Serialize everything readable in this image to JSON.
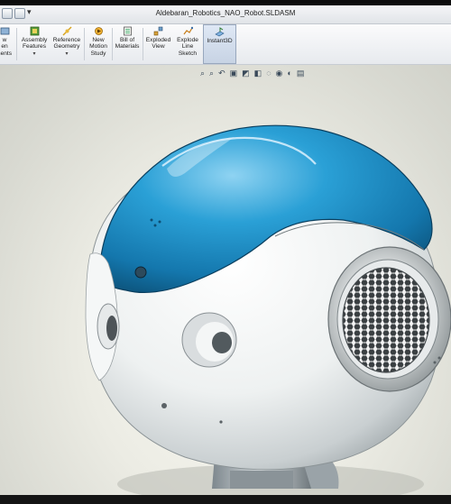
{
  "window": {
    "title": "Aldebaran_Robotics_NAO_Robot.SLDASM"
  },
  "ribbon": {
    "partial_left": {
      "line1": "w",
      "line2": "en",
      "line3": "nents"
    },
    "assembly_features": {
      "line1": "Assembly",
      "line2": "Features"
    },
    "reference_geometry": {
      "line1": "Reference",
      "line2": "Geometry"
    },
    "new_motion_study": {
      "line1": "New",
      "line2": "Motion",
      "line3": "Study"
    },
    "bill_of_materials": {
      "line1": "Bill of",
      "line2": "Materials"
    },
    "exploded_view": {
      "line1": "Exploded",
      "line2": "View"
    },
    "explode_line_sketch": {
      "line1": "Explode",
      "line2": "Line",
      "line3": "Sketch"
    },
    "instant3d": {
      "label": "Instant3D"
    },
    "dropdown_arrow": "▾"
  },
  "hud": {
    "icons": [
      "zoom-to-fit-icon",
      "zoom-area-icon",
      "previous-view-icon",
      "section-view-icon",
      "view-orientation-icon",
      "display-style-icon",
      "hide-show-icon",
      "edit-appearance-icon",
      "scene-icon",
      "view-settings-icon"
    ],
    "glyphs": [
      "⌕",
      "⌕",
      "↶",
      "▣",
      "◩",
      "◧",
      "◌",
      "◉",
      "◐",
      "▤"
    ]
  },
  "colors": {
    "shell_blue": "#1e8fc6",
    "body_white": "#f4f6f6",
    "background": "#ecece4"
  }
}
